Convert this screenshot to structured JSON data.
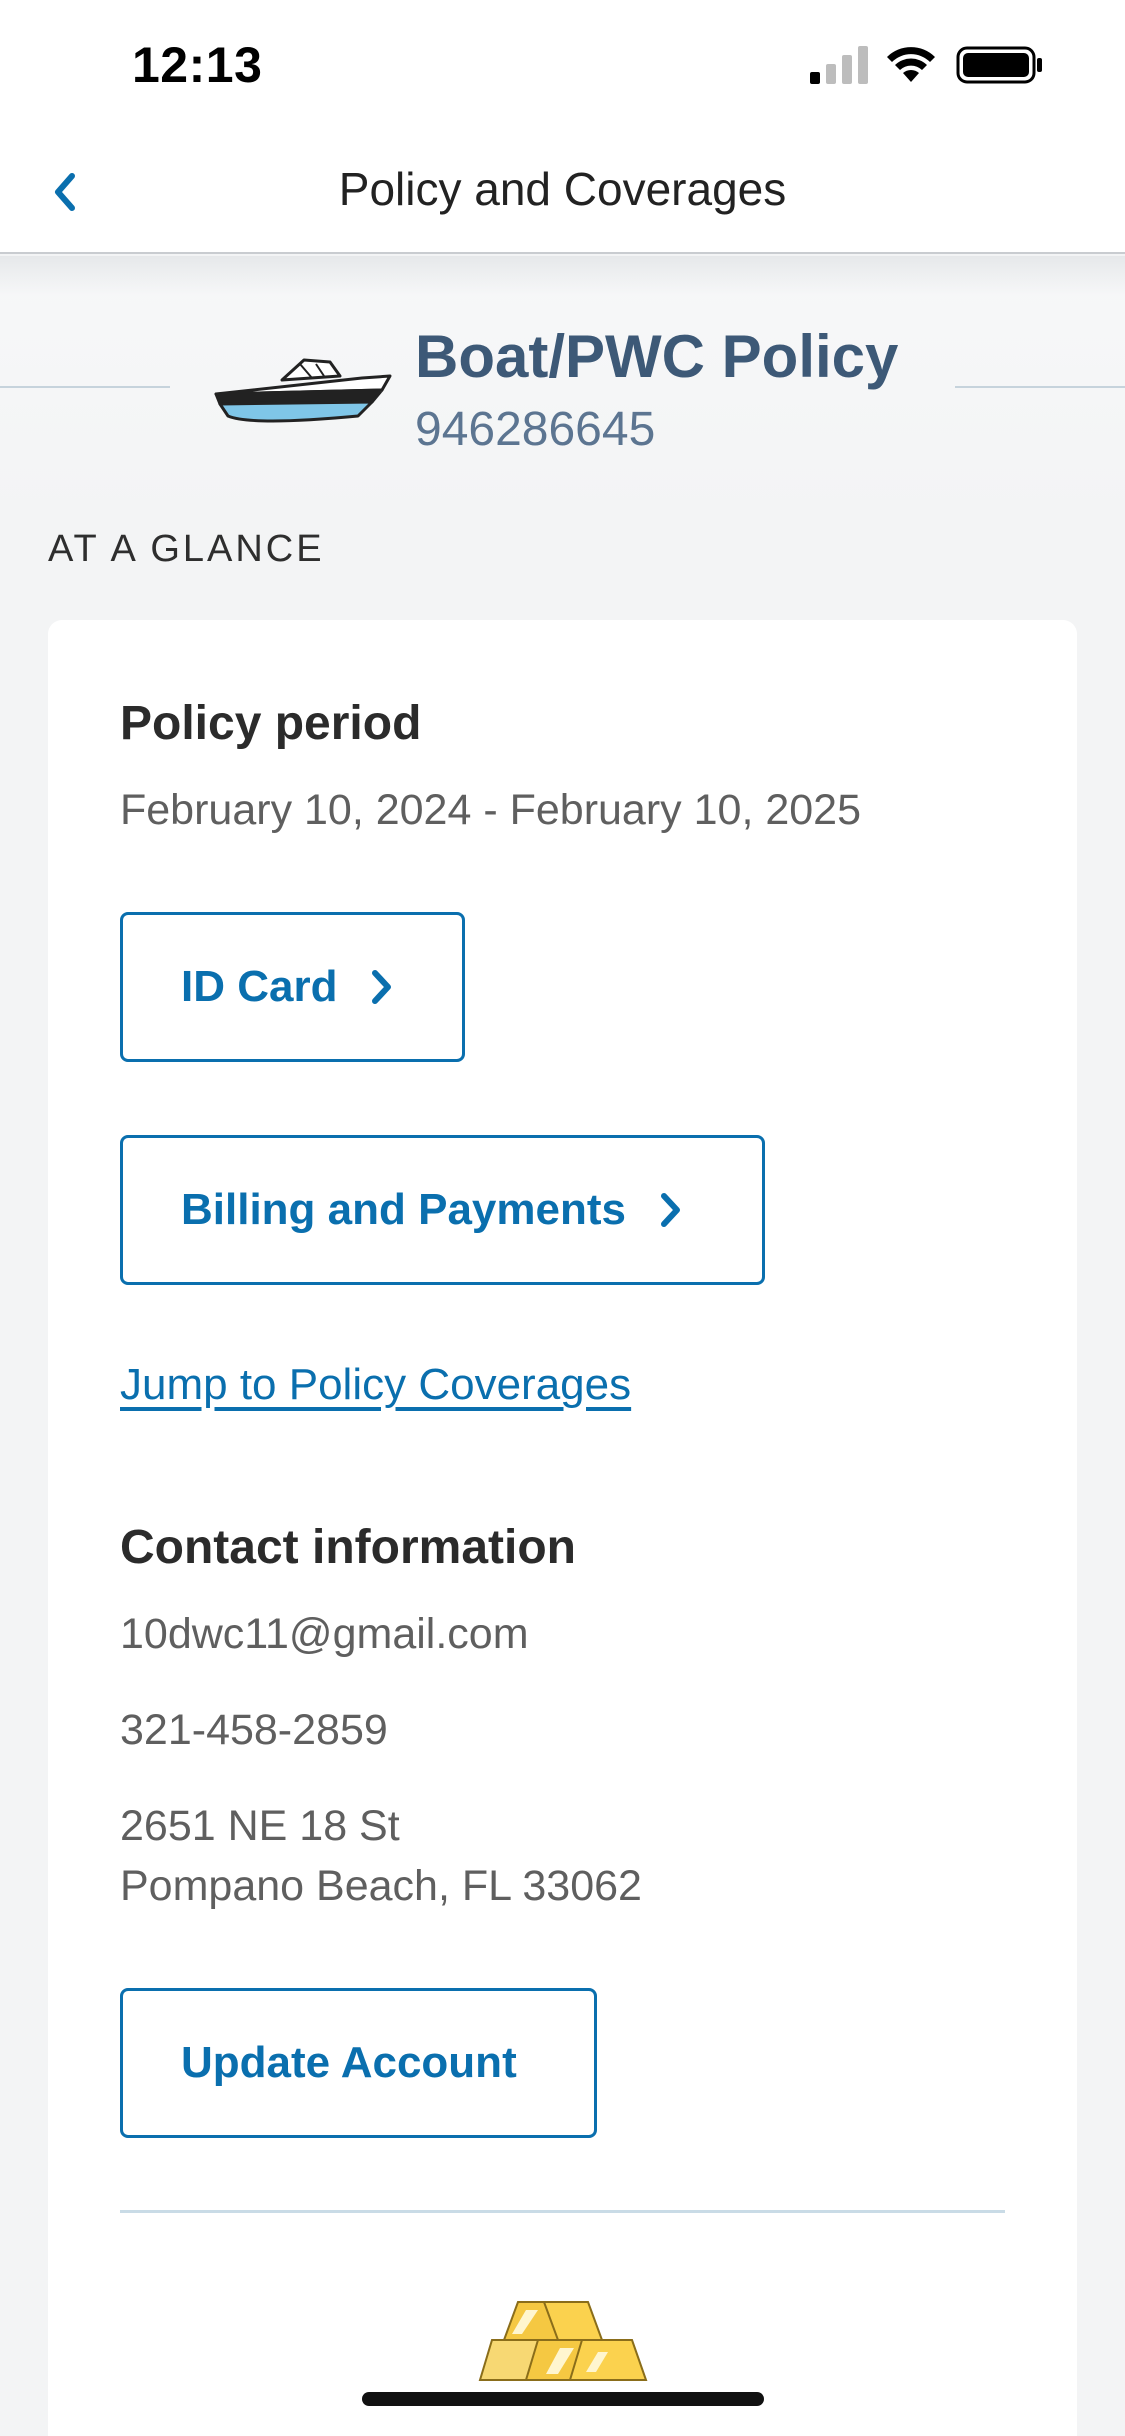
{
  "status_bar": {
    "time": "12:13"
  },
  "nav": {
    "title": "Policy and Coverages",
    "back_icon": "chevron-left-icon"
  },
  "header": {
    "policy_type": "Boat/PWC Policy",
    "policy_number": "946286645",
    "icon": "boat-icon"
  },
  "section_label": "AT A GLANCE",
  "policy_period": {
    "heading": "Policy period",
    "dates": "February 10, 2024 - February 10, 2025"
  },
  "buttons": {
    "id_card": "ID Card",
    "billing": "Billing and Payments",
    "update_account": "Update Account"
  },
  "links": {
    "jump_coverages": "Jump to Policy Coverages"
  },
  "contact": {
    "heading": "Contact information",
    "email": "10dwc11@gmail.com",
    "phone": "321-458-2859",
    "address_line1": "2651 NE 18 St",
    "address_line2": "Pompano Beach, FL 33062"
  },
  "colors": {
    "accent": "#0a6fae",
    "title": "#3d5977",
    "coins": "#f5c842"
  }
}
